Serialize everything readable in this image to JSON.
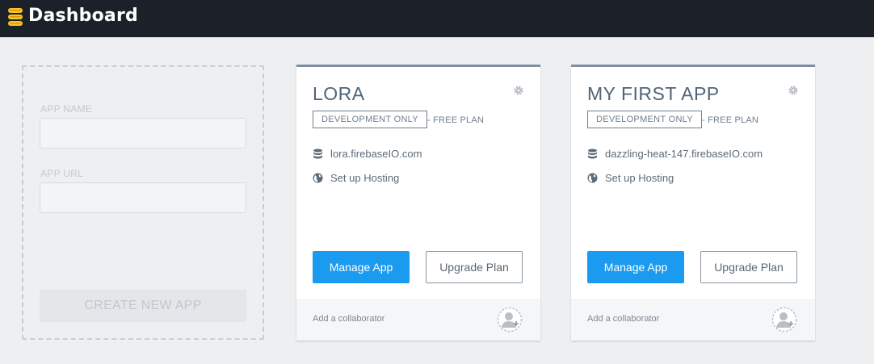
{
  "header": {
    "title": "Dashboard",
    "logo_icon": "firebase-stack-icon",
    "bg_color": "#1c2028"
  },
  "new_app_form": {
    "name_label": "APP NAME",
    "name_value": "",
    "url_label": "APP URL",
    "url_value": "",
    "create_label": "CREATE NEW APP"
  },
  "apps": [
    {
      "name": "LORA",
      "plan_badge": "DEVELOPMENT ONLY",
      "plan_suffix": "- FREE PLAN",
      "database_url": "lora.firebaseIO.com",
      "hosting_label": "Set up Hosting",
      "manage_label": "Manage App",
      "upgrade_label": "Upgrade Plan",
      "collaborator_label": "Add a collaborator"
    },
    {
      "name": "MY FIRST APP",
      "plan_badge": "DEVELOPMENT ONLY",
      "plan_suffix": "- FREE PLAN",
      "database_url": "dazzling-heat-147.firebaseIO.com",
      "hosting_label": "Set up Hosting",
      "manage_label": "Manage App",
      "upgrade_label": "Upgrade Plan",
      "collaborator_label": "Add a collaborator"
    }
  ],
  "colors": {
    "accent": "#1a9bf0",
    "card_top_border": "#7e8ea0"
  }
}
